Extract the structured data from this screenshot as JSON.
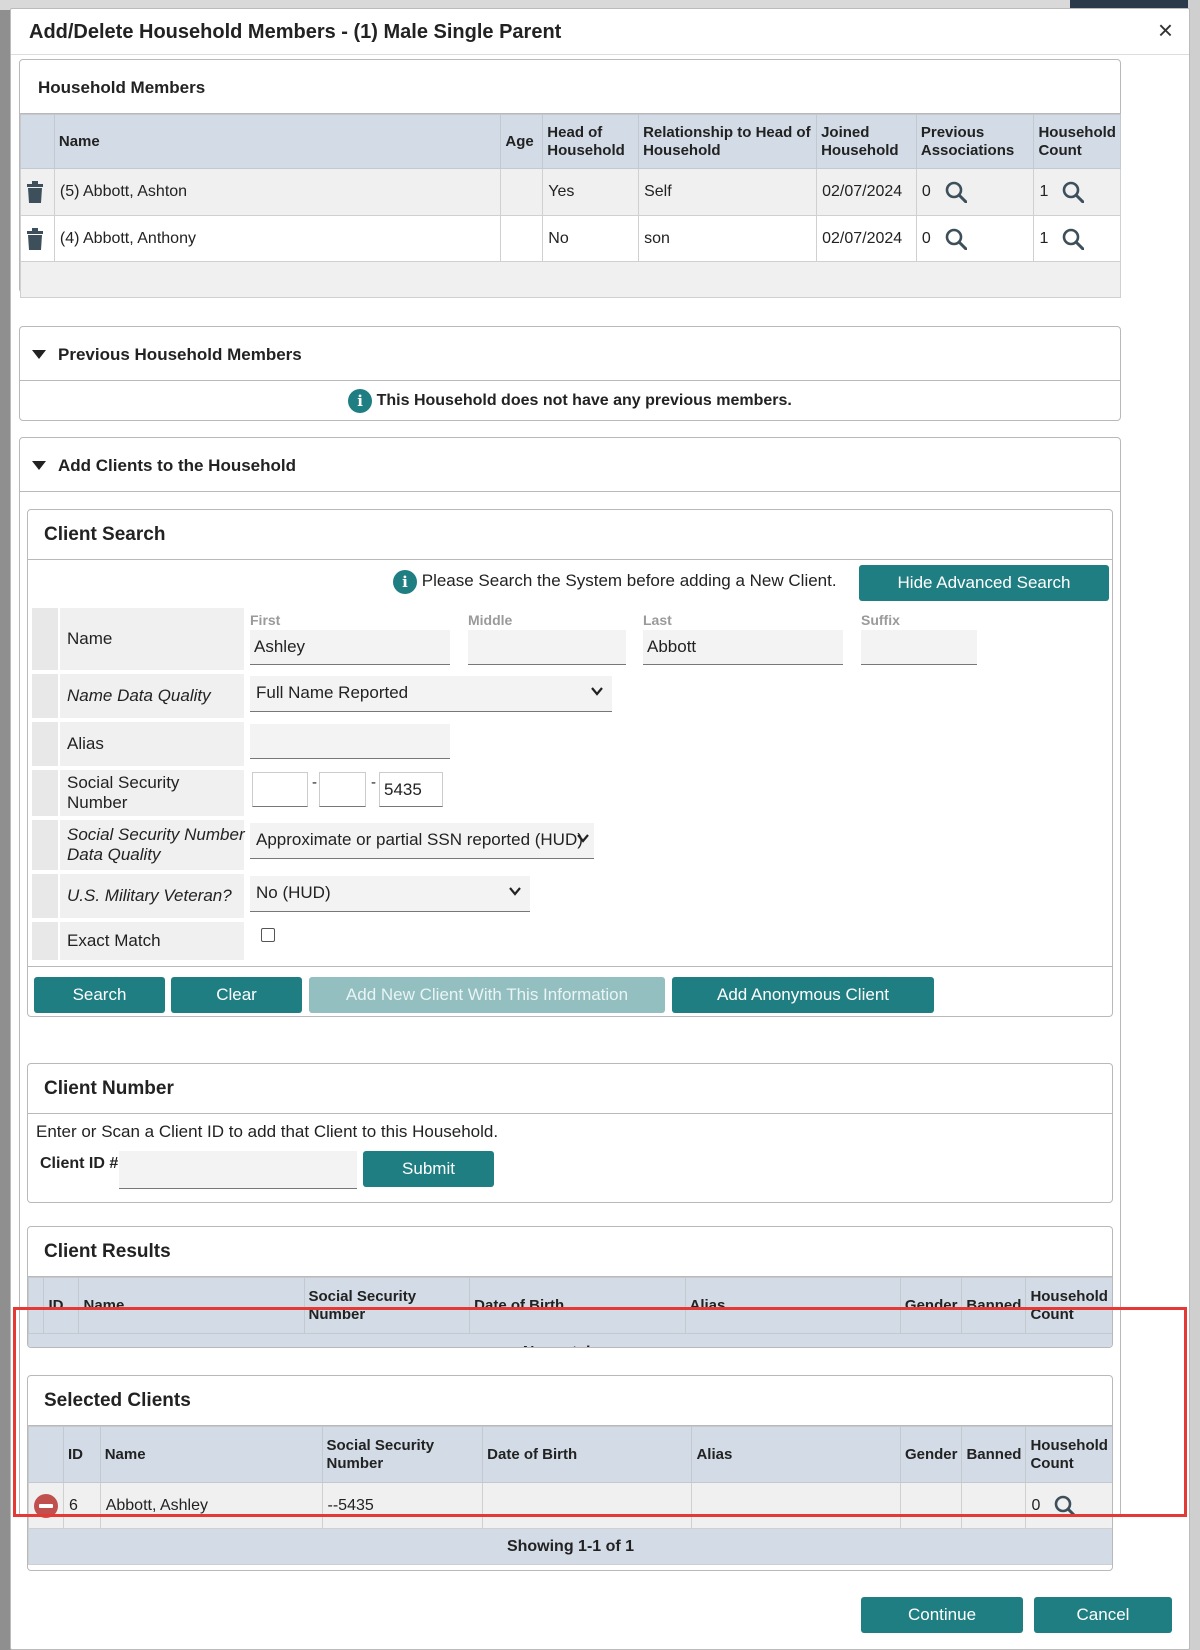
{
  "modal": {
    "title": "Add/Delete Household Members - (1) Male Single Parent",
    "close": "×"
  },
  "household_members": {
    "title": "Household Members",
    "columns": [
      "Name",
      "Age",
      "Head of Household",
      "Relationship to Head of Household",
      "Joined Household",
      "Previous Associations",
      "Household Count"
    ],
    "rows": [
      {
        "name": "(5) Abbott, Ashton",
        "age": "",
        "head": "Yes",
        "relationship": "Self",
        "joined": "02/07/2024",
        "prev": "0",
        "count": "1"
      },
      {
        "name": "(4) Abbott, Anthony",
        "age": "",
        "head": "No",
        "relationship": "son",
        "joined": "02/07/2024",
        "prev": "0",
        "count": "1"
      }
    ]
  },
  "previous_members": {
    "title": "Previous Household Members",
    "message": "This Household does not have any previous members."
  },
  "add_clients": {
    "title": "Add Clients to the Household"
  },
  "client_search": {
    "title": "Client Search",
    "notice": "Please Search the System before adding a New Client.",
    "hide_advanced": "Hide Advanced Search",
    "name_label": "Name",
    "first_label": "First",
    "middle_label": "Middle",
    "last_label": "Last",
    "suffix_label": "Suffix",
    "first": "Ashley",
    "middle": "",
    "last": "Abbott",
    "suffix": "",
    "name_quality_label": "Name Data Quality",
    "name_quality": "Full Name Reported",
    "alias_label": "Alias",
    "alias": "",
    "ssn_label": "Social Security Number",
    "ssn1": "",
    "ssn2": "",
    "ssn3": "5435",
    "dash": "-",
    "ssn_quality_label": "Social Security Number Data Quality",
    "ssn_quality": "Approximate or partial SSN reported (HUD)",
    "veteran_label": "U.S. Military Veteran?",
    "veteran": "No (HUD)",
    "exact_label": "Exact Match",
    "search_btn": "Search",
    "clear_btn": "Clear",
    "add_new_btn": "Add New Client With This Information",
    "add_anon_btn": "Add Anonymous Client"
  },
  "client_number": {
    "title": "Client Number",
    "instructions": "Enter or Scan a Client ID to add that Client to this Household.",
    "id_label": "Client ID #",
    "id_value": "",
    "submit": "Submit"
  },
  "client_results": {
    "title": "Client Results",
    "columns": [
      "ID",
      "Name",
      "Social Security Number",
      "Date of Birth",
      "Alias",
      "Gender",
      "Banned",
      "Household Count"
    ],
    "empty": "No matches."
  },
  "selected_clients": {
    "title": "Selected Clients",
    "columns": [
      "ID",
      "Name",
      "Social Security Number",
      "Date of Birth",
      "Alias",
      "Gender",
      "Banned",
      "Household Count"
    ],
    "rows": [
      {
        "id": "6",
        "name": "Abbott, Ashley",
        "ssn": "--5435",
        "dob": "",
        "alias": "",
        "gender": "",
        "banned": "",
        "count": "0"
      }
    ],
    "footer": "Showing 1-1 of 1"
  },
  "footer": {
    "continue": "Continue",
    "cancel": "Cancel"
  },
  "colors": {
    "accent": "#1e7e82",
    "header_bg": "#d3dce6",
    "highlight": "#e53935",
    "remove": "#c0504d"
  }
}
